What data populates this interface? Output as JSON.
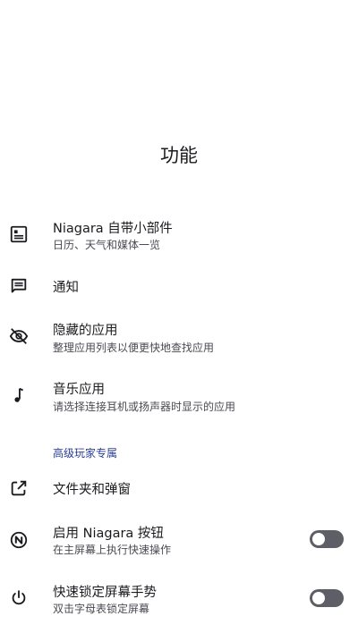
{
  "page": {
    "title": "功能"
  },
  "items": [
    {
      "title": "Niagara 自带小部件",
      "subtitle": "日历、天气和媒体一览",
      "icon": "widget-icon"
    },
    {
      "title": "通知",
      "subtitle": "",
      "icon": "notification-chat-icon"
    },
    {
      "title": "隐藏的应用",
      "subtitle": "整理应用列表以便更快地查找应用",
      "icon": "eye-off-icon"
    },
    {
      "title": "音乐应用",
      "subtitle": "请选择连接耳机或扬声器时显示的应用",
      "icon": "music-note-icon"
    }
  ],
  "section": {
    "header": "高级玩家专属"
  },
  "pro_items": [
    {
      "title": "文件夹和弹窗",
      "subtitle": "",
      "icon": "open-in-new-icon"
    },
    {
      "title": "启用 Niagara 按钮",
      "subtitle": "在主屏幕上执行快速操作",
      "icon": "niagara-n-icon",
      "toggle": "off"
    },
    {
      "title": "快速锁定屏幕手势",
      "subtitle": "双击字母表锁定屏幕",
      "icon": "power-icon",
      "toggle": "off"
    }
  ],
  "colors": {
    "accent": "#2a3e94",
    "toggle_off_track": "#5e5e66",
    "text_primary": "#1b1b1f",
    "text_secondary": "#4a4a52"
  }
}
